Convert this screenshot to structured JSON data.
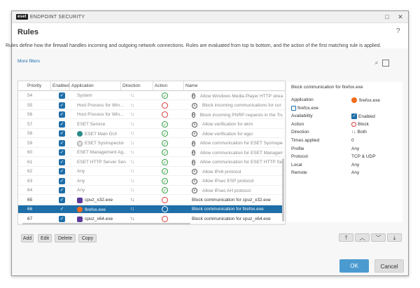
{
  "window": {
    "brand_logo": "eset",
    "brand_title": "ENDPOINT SECURITY",
    "restore_icon": "restore-icon",
    "close_icon": "close-icon"
  },
  "header": {
    "title": "Rules",
    "help": "?"
  },
  "description": "Rules define how the firewall handles incoming and outgoing network connections. Rules are evaluated from top to bottom, and the action of the first matching rule is applied.",
  "more_filters": "More filters",
  "table": {
    "columns": [
      "Priority",
      "Enabled",
      "Application",
      "Direction",
      "Action",
      "Name"
    ],
    "rows": [
      {
        "priority": "54",
        "enabled": true,
        "app": "System",
        "app_icon": "",
        "direction": "↑↓",
        "action": "allow",
        "name": "Allow Windows Media Player HTTP strea",
        "disabled": true
      },
      {
        "priority": "55",
        "enabled": true,
        "app": "Host Process for Win...",
        "app_icon": "",
        "direction": "↑↓",
        "action": "block",
        "name": "Block incoming communications for cor",
        "disabled": true
      },
      {
        "priority": "56",
        "enabled": true,
        "app": "Host Process for Win...",
        "app_icon": "",
        "direction": "↑↓",
        "action": "block",
        "name": "Block incoming PNRP requests in the Tru",
        "disabled": true
      },
      {
        "priority": "57",
        "enabled": true,
        "app": "ESET Service",
        "app_icon": "",
        "direction": "↑↓",
        "action": "allow",
        "name": "Allow verification for ekrn",
        "disabled": true
      },
      {
        "priority": "58",
        "enabled": true,
        "app": "ESET Main GUI",
        "app_icon": "eset",
        "direction": "↑↓",
        "action": "allow",
        "name": "Allow verification for egui",
        "disabled": true
      },
      {
        "priority": "59",
        "enabled": true,
        "app": "ESET SysInspector",
        "app_icon": "sys",
        "direction": "↑↓",
        "action": "allow",
        "name": "Allow communication for ESET SysInspec",
        "disabled": true
      },
      {
        "priority": "60",
        "enabled": true,
        "app": "ESET Management Ag...",
        "app_icon": "",
        "direction": "↑↓",
        "action": "allow",
        "name": "Allow communication for ESET Manageme",
        "disabled": true
      },
      {
        "priority": "61",
        "enabled": true,
        "app": "ESET HTTP Server Serv...",
        "app_icon": "",
        "direction": "↑↓",
        "action": "allow",
        "name": "Allow communication for ESET HTTP Serv",
        "disabled": true
      },
      {
        "priority": "62",
        "enabled": true,
        "app": "Any",
        "app_icon": "",
        "direction": "↑↓",
        "action": "allow",
        "name": "Allow IPv6 protocol",
        "disabled": true
      },
      {
        "priority": "63",
        "enabled": true,
        "app": "Any",
        "app_icon": "",
        "direction": "↑↓",
        "action": "allow",
        "name": "Allow IPsec ESP protocol",
        "disabled": true
      },
      {
        "priority": "64",
        "enabled": true,
        "app": "Any",
        "app_icon": "",
        "direction": "↑↓",
        "action": "allow",
        "name": "Allow IPsec AH protocol",
        "disabled": true
      },
      {
        "priority": "65",
        "enabled": true,
        "app": "cpuz_x32.exe",
        "app_icon": "cpu",
        "direction": "↑↓",
        "action": "block",
        "name": "Block communication for cpuz_x32.exe",
        "disabled": false
      },
      {
        "priority": "66",
        "enabled": true,
        "app": "firefox.exe",
        "app_icon": "ff",
        "direction": "↑↓",
        "action": "block",
        "name": "Block communication for firefox.exe",
        "disabled": false,
        "selected": true
      },
      {
        "priority": "67",
        "enabled": true,
        "app": "cpuz_x64.exe",
        "app_icon": "cpu",
        "direction": "↑↓",
        "action": "block",
        "name": "Block communication for cpuz_x64.exe",
        "disabled": false
      }
    ]
  },
  "details": {
    "title": "Block communication for firefox.exe",
    "fields": [
      {
        "key": "Application",
        "value": "firefox.exe"
      },
      {
        "key": "",
        "value": "firefox.exe"
      },
      {
        "key": "Availability",
        "value": "Enabled"
      },
      {
        "key": "Action",
        "value": "Block"
      },
      {
        "key": "Direction",
        "value": "Both"
      },
      {
        "key": "Times applied",
        "value": "0"
      },
      {
        "key": "Profile",
        "value": "Any"
      },
      {
        "key": "Protocol",
        "value": "TCP & UDP"
      },
      {
        "key": "Local",
        "value": "Any"
      },
      {
        "key": "Remote",
        "value": "Any"
      }
    ]
  },
  "buttons": {
    "add": "Add",
    "edit": "Edit",
    "delete": "Delete",
    "copy": "Copy",
    "ok": "OK",
    "cancel": "Cancel"
  },
  "colors": {
    "accent": "#1e6ea8",
    "ok": "#4b9bd0",
    "allow": "#2e9e3e",
    "block": "#d83a3a"
  }
}
